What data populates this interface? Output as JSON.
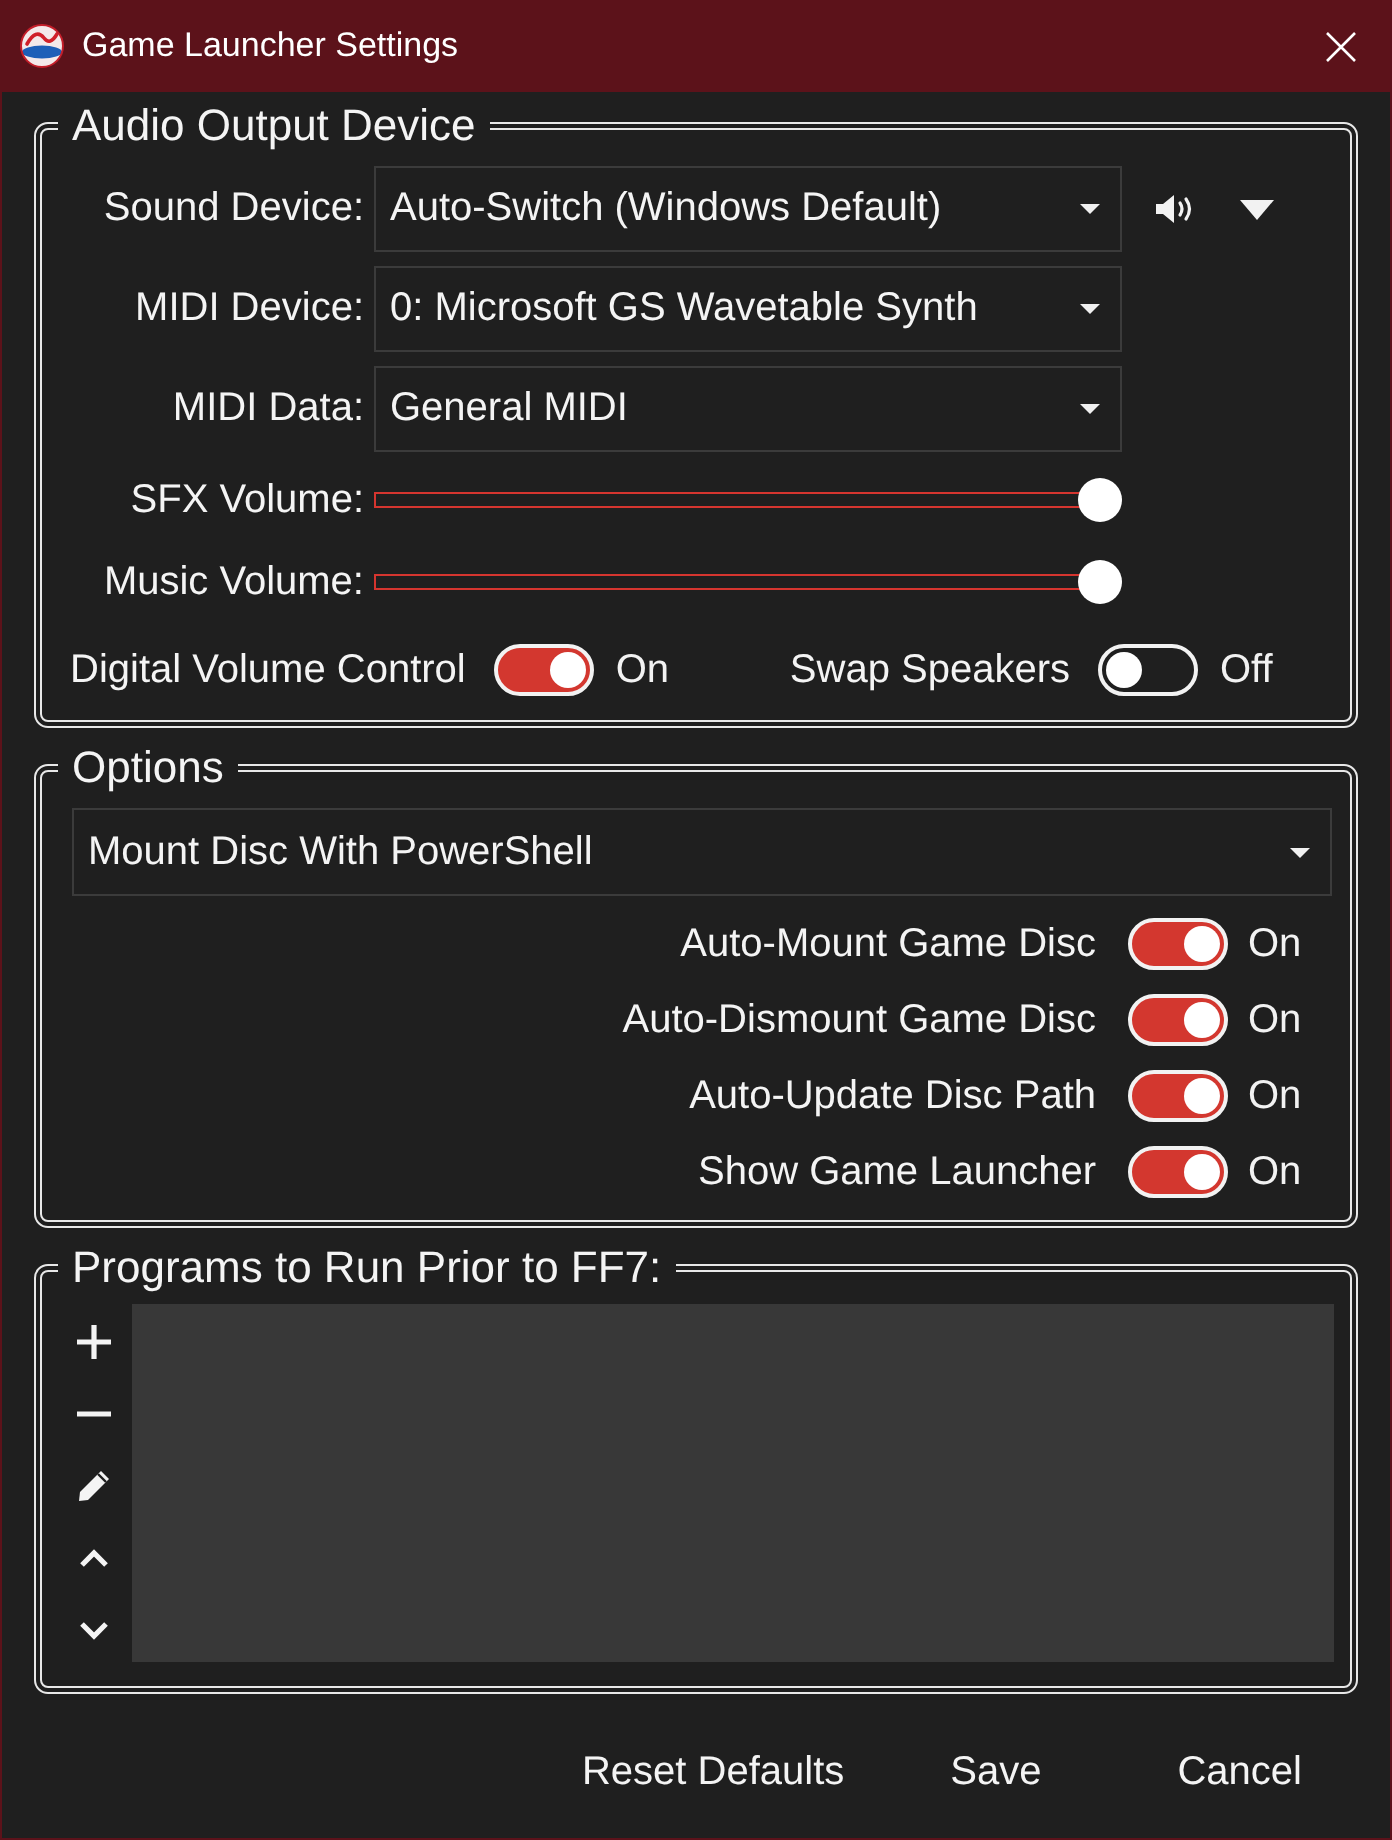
{
  "window": {
    "title": "Game Launcher Settings"
  },
  "audio_output_device": {
    "title": "Audio Output Device",
    "devices": [
      {
        "kind": "output",
        "label": "Sound Device:",
        "value": "Auto-Switch (Windows Default)"
      },
      {
        "kind": "select",
        "label": "MIDI Device:",
        "value": "0: Microsoft GS Wavetable Synth"
      },
      {
        "kind": "select",
        "label": "MIDI Data:",
        "value": "General MIDI"
      }
    ],
    "volumes": [
      {
        "label": "SFX Volume:",
        "level": 1
      },
      {
        "label": "Music Volume:",
        "level": 1
      }
    ],
    "switches": [
      {
        "label": "Digital Volume Control",
        "on": true,
        "state": "On"
      },
      {
        "label": "Swap Speakers",
        "on": false,
        "state": "Off"
      }
    ]
  },
  "options": {
    "title": "Options",
    "mount_method": "Mount Disc With PowerShell",
    "switches": [
      {
        "label": "Auto-Mount Game Disc",
        "on": true,
        "state": "On"
      },
      {
        "label": "Auto-Dismount Game Disc",
        "on": true,
        "state": "On"
      },
      {
        "label": "Auto-Update Disc Path",
        "on": true,
        "state": "On"
      },
      {
        "label": "Show Game Launcher",
        "on": true,
        "state": "On"
      }
    ]
  },
  "programs": {
    "title": "Programs to Run Prior to FF7:"
  },
  "buttons": [
    "Reset Defaults",
    "Save",
    "Cancel"
  ]
}
